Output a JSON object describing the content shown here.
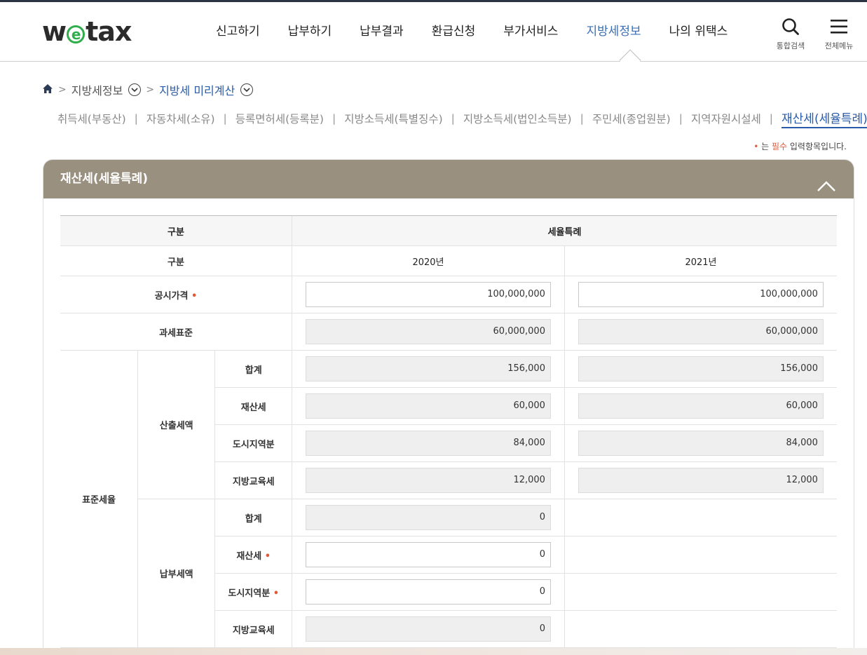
{
  "header": {
    "logo": "wetax",
    "nav": [
      "신고하기",
      "납부하기",
      "납부결과",
      "환급신청",
      "부가서비스",
      "지방세정보",
      "나의 위택스"
    ],
    "nav_active_index": 5,
    "search_label": "통합검색",
    "menu_label": "전체메뉴"
  },
  "breadcrumb": {
    "level1": "지방세정보",
    "level2": "지방세 미리계산"
  },
  "subtabs": [
    "취득세(부동산)",
    "자동차세(소유)",
    "등록면허세(등록분)",
    "지방소득세(특별징수)",
    "지방소득세(법인소득분)",
    "주민세(종업원분)",
    "지역자원시설세",
    "재산세(세율특례)"
  ],
  "required_note": {
    "bullet": "•",
    "prefix": "는 ",
    "strong": "필수",
    "suffix": " 입력항목입니다."
  },
  "panel": {
    "title": "재산세(세율특례)",
    "table": {
      "header_left": "구분",
      "header_right": "세율특례",
      "sub_left": "구분",
      "year1": "2020년",
      "year2": "2021년",
      "rows": {
        "price_label": "공시가격",
        "price_2020": "100,000,000",
        "price_2021": "100,000,000",
        "base_label": "과세표준",
        "base_2020": "60,000,000",
        "base_2021": "60,000,000",
        "group_label": "표준세율",
        "calc_label": "산출세액",
        "calc_total_label": "합계",
        "calc_total_2020": "156,000",
        "calc_total_2021": "156,000",
        "calc_prop_label": "재산세",
        "calc_prop_2020": "60,000",
        "calc_prop_2021": "60,000",
        "calc_city_label": "도시지역분",
        "calc_city_2020": "84,000",
        "calc_city_2021": "84,000",
        "calc_edu_label": "지방교육세",
        "calc_edu_2020": "12,000",
        "calc_edu_2021": "12,000",
        "pay_label": "납부세액",
        "pay_total_label": "합계",
        "pay_total_2020": "0",
        "pay_prop_label": "재산세",
        "pay_prop_2020": "0",
        "pay_city_label": "도시지역분",
        "pay_city_2020": "0",
        "pay_edu_label": "지방교육세",
        "pay_edu_2020": "0"
      }
    }
  },
  "colors": {
    "accent": "#3d6fb8",
    "panel_header": "#9a9080",
    "required_dot": "#e05a3a",
    "logo_green": "#2fae4b"
  },
  "icons": {
    "home": "home-icon",
    "search": "search-icon",
    "menu": "hamburger-icon",
    "collapse": "chevron-up-icon"
  }
}
